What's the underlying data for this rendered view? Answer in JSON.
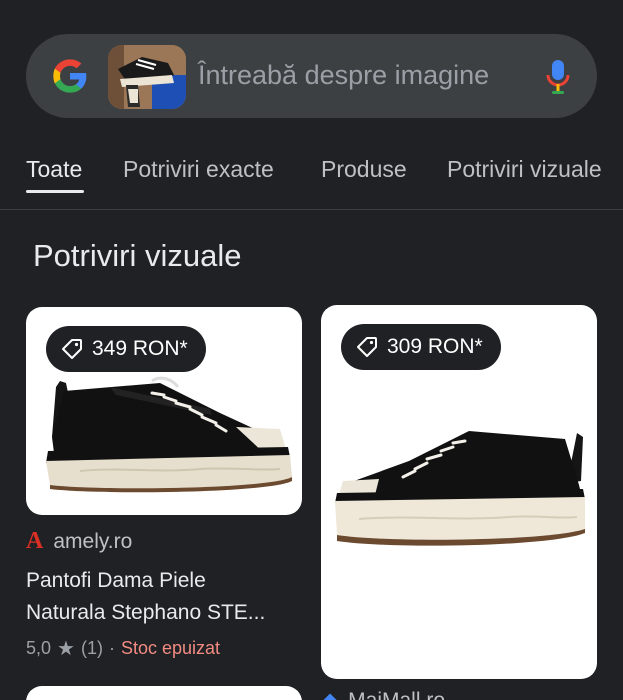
{
  "search": {
    "placeholder": "Întreabă despre imagine",
    "logo_icon": "google-g-icon",
    "mic_icon": "microphone-icon"
  },
  "tabs": [
    {
      "label": "Toate",
      "active": true
    },
    {
      "label": "Potriviri exacte",
      "active": false
    },
    {
      "label": "Produse",
      "active": false
    },
    {
      "label": "Potriviri vizuale",
      "active": false
    }
  ],
  "section": {
    "title": "Potriviri vizuale"
  },
  "results": [
    {
      "price": "349 RON*",
      "source": "amely.ro",
      "source_logo": "A",
      "title_line1": "Pantofi Dama Piele",
      "title_line2": "Naturala Stephano STE...",
      "rating": "5,0",
      "reviews": "(1)",
      "separator": "·",
      "stock": "Stoc epuizat"
    },
    {
      "price": "309 RON*",
      "source": "MaiMall.ro"
    }
  ],
  "colors": {
    "background": "#202124",
    "search_bg": "#3c4043",
    "stock_red": "#f28b82",
    "brand_red": "#d93025"
  }
}
